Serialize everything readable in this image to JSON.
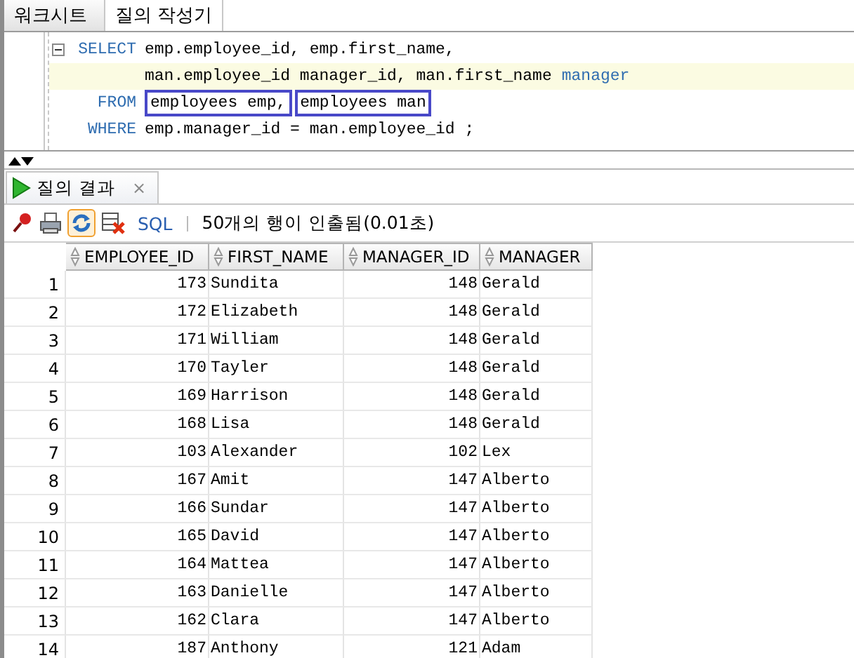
{
  "tabs": [
    {
      "label": "워크시트",
      "selected": true
    },
    {
      "label": "질의 작성기",
      "selected": false
    }
  ],
  "editor": {
    "lines": [
      {
        "keyword": "SELECT",
        "current": false,
        "fold": true,
        "tokens": [
          {
            "kind": "plain",
            "text": "emp.employee_id, emp.first_name,"
          }
        ]
      },
      {
        "current": true,
        "fold": false,
        "tokens": [
          {
            "kind": "plain",
            "text": "man.employee_id manager_id, man.first_name"
          },
          {
            "kind": "keyword",
            "text": "manager"
          }
        ]
      },
      {
        "keyword": "FROM",
        "current": false,
        "fold": false,
        "tokens": [
          {
            "kind": "boxed",
            "text": "employees emp,"
          },
          {
            "kind": "boxed",
            "text": "employees man"
          }
        ]
      },
      {
        "keyword": "WHERE",
        "current": false,
        "fold": false,
        "tokens": [
          {
            "kind": "plain",
            "text": "emp.manager_id = man.employee_id ;"
          }
        ]
      }
    ]
  },
  "results": {
    "tab": {
      "label": "질의 결과",
      "close": "×"
    },
    "toolbar": {
      "sql_link": "SQL",
      "status": "50개의 행이 인출됨(0.01초)",
      "refresh_selected": true
    },
    "columns": [
      "",
      "EMPLOYEE_ID",
      "FIRST_NAME",
      "MANAGER_ID",
      "MANAGER"
    ],
    "rows": [
      [
        "1",
        "173",
        "Sundita",
        "148",
        "Gerald"
      ],
      [
        "2",
        "172",
        "Elizabeth",
        "148",
        "Gerald"
      ],
      [
        "3",
        "171",
        "William",
        "148",
        "Gerald"
      ],
      [
        "4",
        "170",
        "Tayler",
        "148",
        "Gerald"
      ],
      [
        "5",
        "169",
        "Harrison",
        "148",
        "Gerald"
      ],
      [
        "6",
        "168",
        "Lisa",
        "148",
        "Gerald"
      ],
      [
        "7",
        "103",
        "Alexander",
        "102",
        "Lex"
      ],
      [
        "8",
        "167",
        "Amit",
        "147",
        "Alberto"
      ],
      [
        "9",
        "166",
        "Sundar",
        "147",
        "Alberto"
      ],
      [
        "10",
        "165",
        "David",
        "147",
        "Alberto"
      ],
      [
        "11",
        "164",
        "Mattea",
        "147",
        "Alberto"
      ],
      [
        "12",
        "163",
        "Danielle",
        "147",
        "Alberto"
      ],
      [
        "13",
        "162",
        "Clara",
        "147",
        "Alberto"
      ],
      [
        "14",
        "187",
        "Anthony",
        "121",
        "Adam"
      ]
    ]
  }
}
